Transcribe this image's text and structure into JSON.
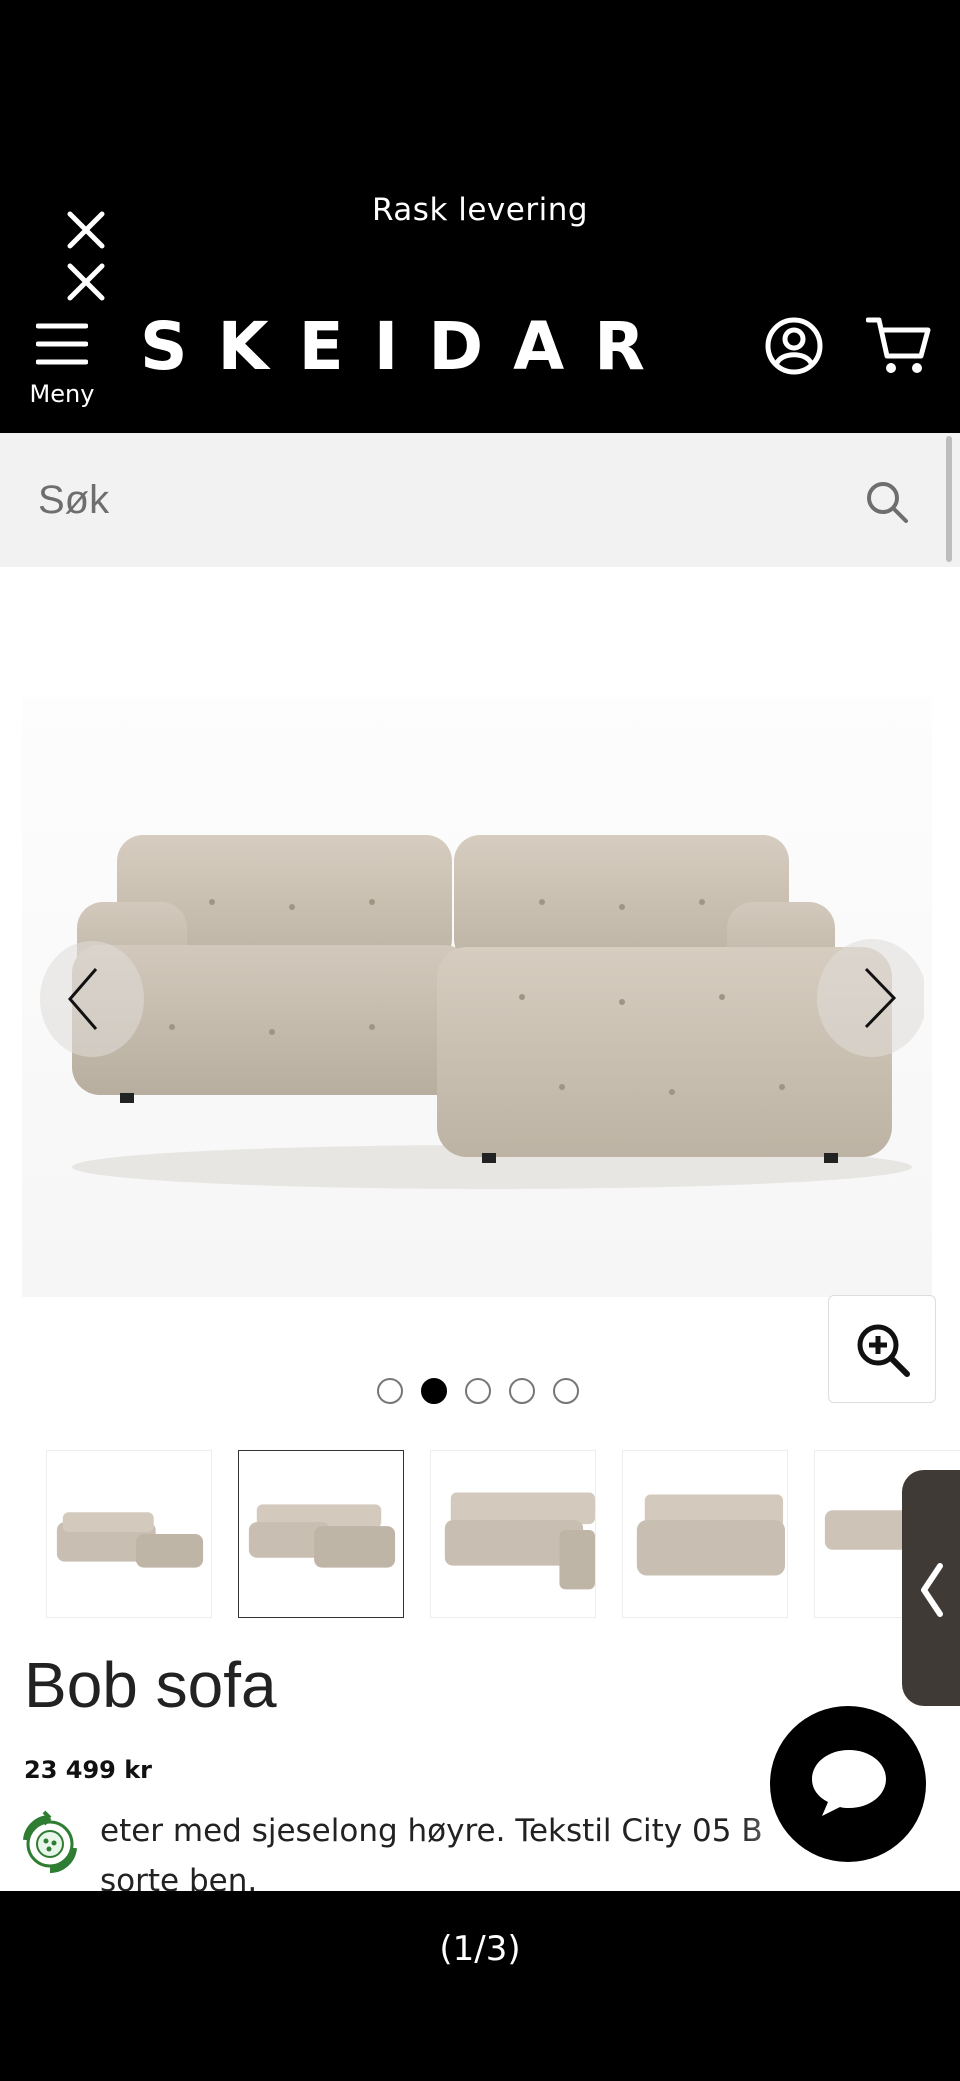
{
  "header": {
    "promo_text": "Rask levering",
    "menu_label": "Meny",
    "logo_text": "SKEIDAR"
  },
  "search": {
    "placeholder": "Søk"
  },
  "gallery": {
    "image_count": 5,
    "active_index": 1,
    "thumbnails": [
      "sofa-corner-left",
      "sofa-chaise-right",
      "sofa-side",
      "sofa-angle",
      "sofa-back"
    ]
  },
  "product": {
    "title": "Bob sofa",
    "price": "23 499 kr",
    "description_line1": "eter med sjeselong høyre. Tekstil City 05 B",
    "description_line2": "sorte ben."
  },
  "pager": {
    "text": "(1/3)"
  },
  "colors": {
    "header_bg": "#000000",
    "search_bg": "#f2f2f2",
    "sofa_fabric": "#cfc6b8",
    "drawer_bg": "#3f3a35",
    "eco_green": "#2e7d32"
  }
}
